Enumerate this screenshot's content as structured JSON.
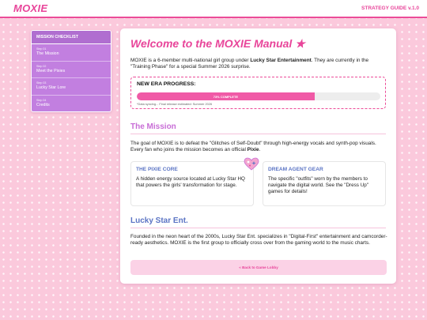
{
  "header": {
    "logo": "MOXIE",
    "version": "STRATEGY GUIDE v.1.0"
  },
  "sidebar": {
    "title": "MISSION CHECKLIST",
    "items": [
      {
        "step": "Step 01",
        "label": "The Mission"
      },
      {
        "step": "Step 02",
        "label": "Meet the Pixies"
      },
      {
        "step": "Step 03",
        "label": "Lucky Star Lore"
      },
      {
        "step": "Step 04",
        "label": "Credits"
      }
    ]
  },
  "main": {
    "title": "Welcome to the MOXIE Manual ★",
    "intro": {
      "before": "MOXIE is a 6-member multi-national girl group under ",
      "strong": "Lucky Star Entertainment",
      "after": ". They are currently in the \"Training Phase\" for a special Summer 2026 surprise."
    },
    "progress": {
      "title": "NEW ERA PROGRESS:",
      "value": 0.73,
      "label": "73% COMPLETE",
      "note": "*Data syncing... Final release estimated: Summer 2026"
    },
    "mission": {
      "heading": "The Mission",
      "text_before": "The goal of MOXIE is to defeat the \"Glitches of Self-Doubt\" through high-energy vocals and synth-pop visuals. Every fan who joins the mission becomes an official ",
      "text_strong": "Pixie",
      "text_after": "."
    },
    "cards": [
      {
        "title": "THE PIXIE CORE",
        "text": "A hidden energy source located at Lucky Star HQ that powers the girls' transformation for stage."
      },
      {
        "title": "DREAM AGENT GEAR",
        "text": "The specific \"outfits\" worn by the members to navigate the digital world. See the \"Dress Up\" games for details!"
      }
    ],
    "lucky": {
      "heading": "Lucky Star Ent.",
      "text": "Founded in the neon heart of the 2000s, Lucky Star Ent. specializes in \"Digital-First\" entertainment and camcorder-ready aesthetics. MOXIE is the first group to officially cross over from the gaming world to the music charts."
    },
    "back_button": "« Back to Game Lobby",
    "sticker_icon": "sparkle-heart-icon"
  },
  "colors": {
    "accent": "#e8459a",
    "sidebar": "#c27fe0",
    "section_purple": "#c86dd6",
    "section_blue": "#5b74c4",
    "background": "#fbc9dc"
  }
}
